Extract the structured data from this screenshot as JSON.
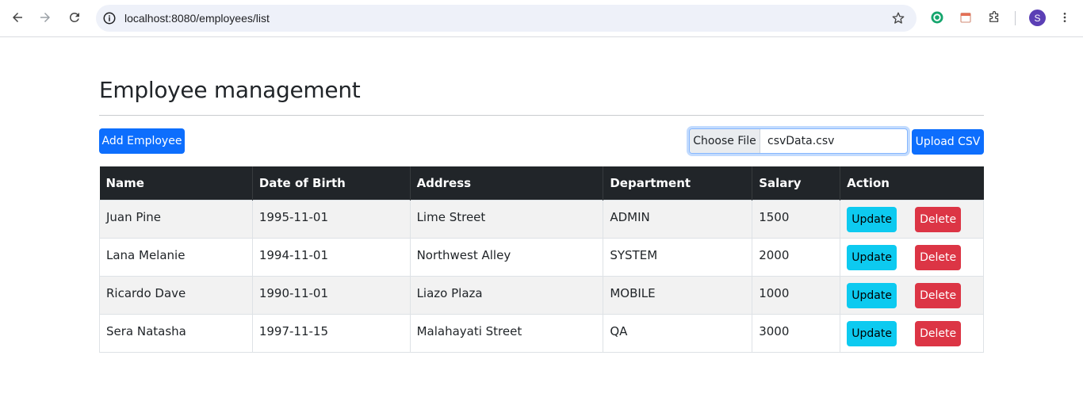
{
  "browser": {
    "url": "localhost:8080/employees/list"
  },
  "page": {
    "title": "Employee management",
    "add_button": "Add Employee",
    "file_input": {
      "choose_label": "Choose File",
      "file_name": "csvData.csv"
    },
    "upload_button": "Upload CSV"
  },
  "table": {
    "headers": [
      "Name",
      "Date of Birth",
      "Address",
      "Department",
      "Salary",
      "Action"
    ],
    "rows": [
      {
        "name": "Juan Pine",
        "dob": "1995-11-01",
        "address": "Lime Street",
        "department": "ADMIN",
        "salary": "1500"
      },
      {
        "name": "Lana Melanie",
        "dob": "1994-11-01",
        "address": "Northwest Alley",
        "department": "SYSTEM",
        "salary": "2000"
      },
      {
        "name": "Ricardo Dave",
        "dob": "1990-11-01",
        "address": "Liazo Plaza",
        "department": "MOBILE",
        "salary": "1000"
      },
      {
        "name": "Sera Natasha",
        "dob": "1997-11-15",
        "address": "Malahayati Street",
        "department": "QA",
        "salary": "3000"
      }
    ],
    "update_label": "Update",
    "delete_label": "Delete"
  },
  "profile": {
    "initial": "S",
    "color": "#5b3fb5"
  },
  "colors": {
    "primary": "#0d6efd",
    "info": "#0dcaf0",
    "danger": "#dc3545",
    "header_bg": "#212529"
  }
}
